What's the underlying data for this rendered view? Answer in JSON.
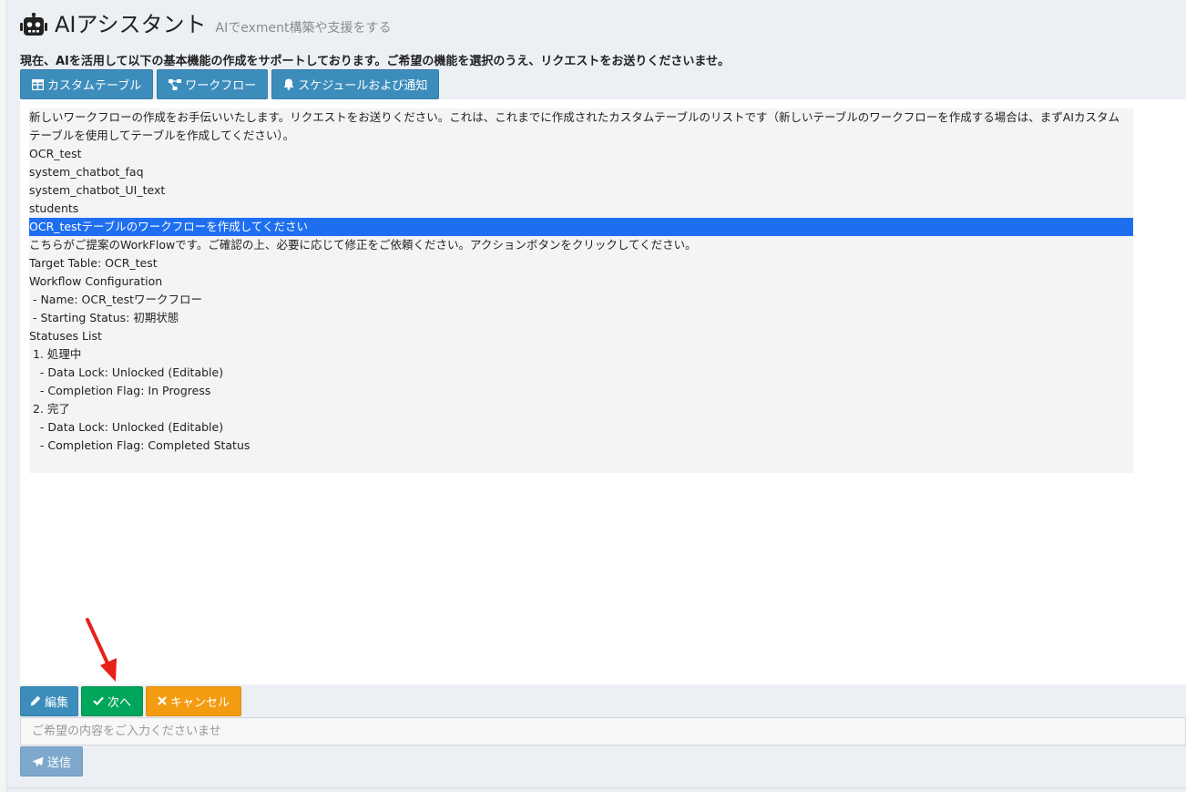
{
  "header": {
    "title": "AIアシスタント",
    "subtitle": "AIでexment構築や支援をする"
  },
  "notice": "現在、AIを活用して以下の基本機能の作成をサポートしております。ご希望の機能を選択のうえ、リクエストをお送りくださいませ。",
  "function_buttons": [
    {
      "label": "カスタムテーブル",
      "icon": "table-icon"
    },
    {
      "label": "ワークフロー",
      "icon": "workflow-icon"
    },
    {
      "label": "スケジュールおよび通知",
      "icon": "bell-icon"
    }
  ],
  "chat": {
    "lines": [
      "新しいワークフローの作成をお手伝いいたします。リクエストをお送りください。これは、これまでに作成されたカスタムテーブルのリストです（新しいテーブルのワークフローを作成する場合は、まずAIカスタムテーブルを使用してテーブルを作成してください）。",
      "OCR_test",
      "system_chatbot_faq",
      "system_chatbot_UI_text",
      "students",
      "OCR_testテーブルのワークフローを作成してください",
      "こちらがご提案のWorkFlowです。ご確認の上、必要に応じて修正をご依頼ください。アクションボタンをクリックしてください。",
      "",
      "Target Table: OCR_test",
      "Workflow Configuration",
      " - Name: OCR_testワークフロー",
      " - Starting Status: 初期状態",
      "Statuses List",
      " 1. 処理中",
      "   - Data Lock: Unlocked (Editable)",
      "   - Completion Flag: In Progress",
      " 2. 完了",
      "   - Data Lock: Unlocked (Editable)",
      "   - Completion Flag: Completed Status"
    ]
  },
  "actions": {
    "edit_label": "編集",
    "next_label": "次へ",
    "cancel_label": "キャンセル"
  },
  "input": {
    "value": "",
    "placeholder": "ご希望の内容をご入力くださいませ"
  },
  "send_label": "送信",
  "colors": {
    "primary": "#3c8dbc",
    "success": "#00a65a",
    "warning": "#f39c12",
    "highlight": "#1e6ff0",
    "annotation_arrow": "#e8201a"
  }
}
